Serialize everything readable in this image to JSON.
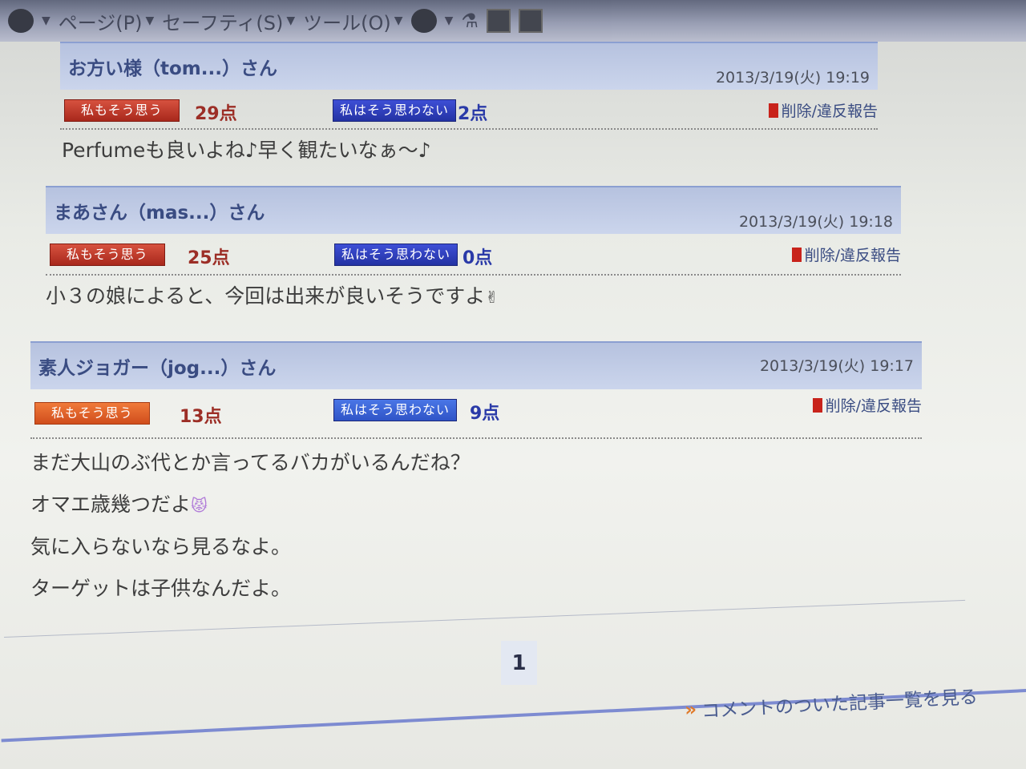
{
  "toolbar": {
    "page": "ページ(P)",
    "safety": "セーフティ(S)",
    "tools": "ツール(O)"
  },
  "comments": [
    {
      "name": "お方い様（tom...）さん",
      "date": "2013/3/19(火) 19:19",
      "agree_label": "私もそう思う",
      "agree_score": "29点",
      "disagree_label": "私はそう思わない",
      "disagree_score": "2点",
      "report": "削除/違反報告",
      "lines": [
        "Perfumeも良いよね♪早く観たいなぁ～♪"
      ]
    },
    {
      "name": "まあさん（mas...）さん",
      "date": "2013/3/19(火) 19:18",
      "agree_label": "私もそう思う",
      "agree_score": "25点",
      "disagree_label": "私はそう思わない",
      "disagree_score": "0点",
      "report": "削除/違反報告",
      "lines": [
        "小３の娘によると、今回は出来が良いそうですよ"
      ]
    },
    {
      "name": "素人ジョガー（jog...）さん",
      "date": "2013/3/19(火) 19:17",
      "agree_label": "私もそう思う",
      "agree_score": "13点",
      "disagree_label": "私はそう思わない",
      "disagree_score": "9点",
      "report": "削除/違反報告",
      "lines": [
        "まだ大山のぶ代とか言ってるバカがいるんだね？",
        "オマエ歳幾つだよ",
        "気に入らないなら見るなよ。",
        "ターゲットは子供なんだよ。"
      ]
    }
  ],
  "pager": {
    "current": "1"
  },
  "more_link": "コメントのついた記事一覧を見る",
  "colors": {
    "agree": "#b8322a",
    "disagree": "#2b3bb8",
    "header_bg": "#c4cfea",
    "link": "#3a4c82"
  }
}
